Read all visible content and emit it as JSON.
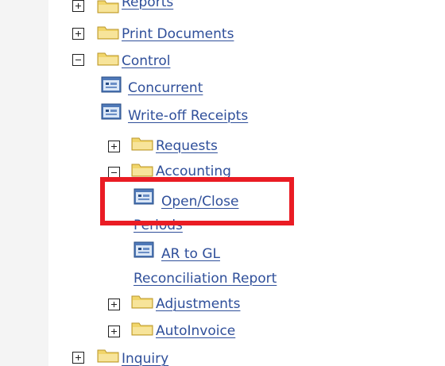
{
  "tree": {
    "items": {
      "reports": {
        "label": "Reports",
        "icon": "folder-icon",
        "toggle": "plus"
      },
      "print_documents": {
        "label": "Print Documents",
        "icon": "folder-icon",
        "toggle": "plus"
      },
      "control": {
        "label": "Control",
        "icon": "folder-icon",
        "toggle": "minus"
      },
      "concurrent": {
        "label": "Concurrent",
        "icon": "function-window-icon"
      },
      "write_off_receipts": {
        "label": "Write-off Receipts",
        "icon": "function-window-icon"
      },
      "requests": {
        "label": "Requests",
        "icon": "folder-icon",
        "toggle": "plus"
      },
      "accounting": {
        "label": "Accounting",
        "icon": "folder-icon",
        "toggle": "minus"
      },
      "open_close_periods": {
        "label_line1": "Open/Close",
        "label_line2": "Periods",
        "icon": "function-window-icon",
        "highlighted": true
      },
      "ar_to_gl": {
        "label_line1": "AR to GL",
        "label_line2": "Reconciliation Report",
        "icon": "function-window-icon"
      },
      "adjustments": {
        "label": "Adjustments",
        "icon": "folder-icon",
        "toggle": "plus"
      },
      "autoinvoice": {
        "label": "AutoInvoice",
        "icon": "folder-icon",
        "toggle": "plus"
      },
      "inquiry": {
        "label": "Inquiry",
        "icon": "folder-icon",
        "toggle": "plus"
      }
    }
  },
  "colors": {
    "link": "#2f4f9a",
    "highlight": "#ea1c24",
    "folder": "#f1d56a",
    "background": "#ffffff"
  }
}
